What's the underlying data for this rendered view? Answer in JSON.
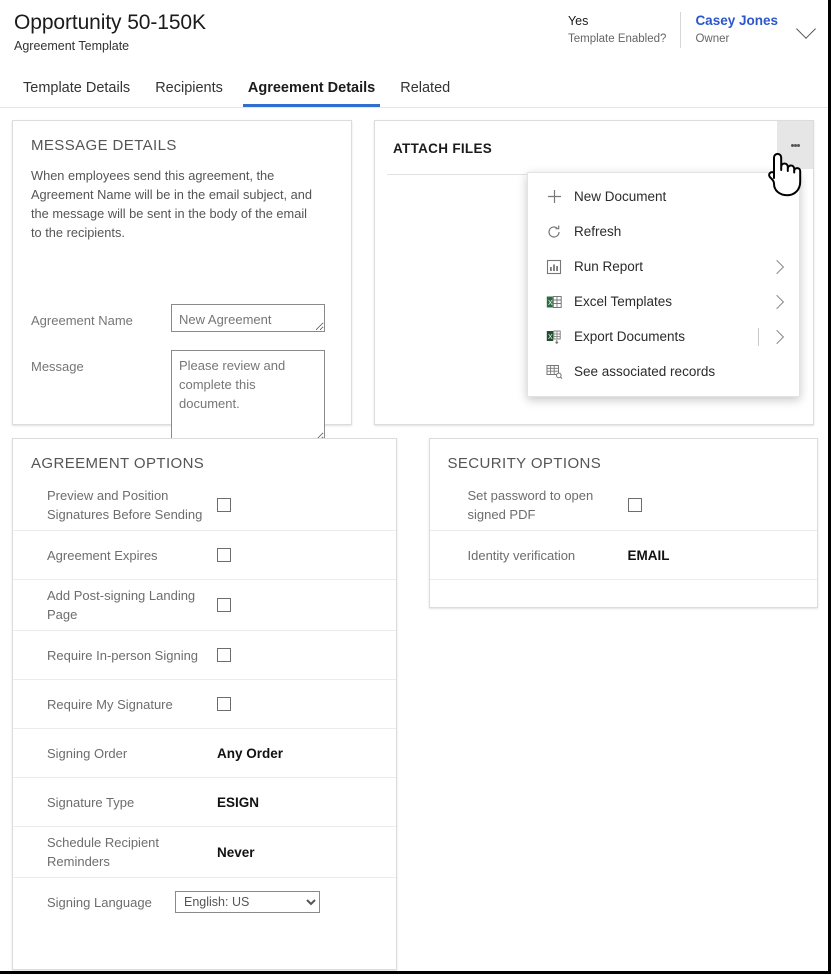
{
  "header": {
    "title": "Opportunity 50-150K",
    "subtitle": "Agreement Template",
    "template_enabled_value": "Yes",
    "template_enabled_label": "Template Enabled?",
    "owner_name": "Casey Jones",
    "owner_label": "Owner",
    "expand_icon": "chevron-down-icon"
  },
  "tabs": [
    {
      "label": "Template Details",
      "active": false
    },
    {
      "label": "Recipients",
      "active": false
    },
    {
      "label": "Agreement Details",
      "active": true
    },
    {
      "label": "Related",
      "active": false
    }
  ],
  "message_details": {
    "title": "MESSAGE DETAILS",
    "description": "When employees send this agreement, the Agreement Name will be in the email subject, and the message will be sent in the body of the email to the recipients.",
    "agreement_name_label": "Agreement Name",
    "agreement_name_value": "New Agreement",
    "message_label": "Message",
    "message_value": "Please review and complete this document."
  },
  "attach_files": {
    "title": "ATTACH FILES",
    "kebab_icon": "more-vertical-icon",
    "menu": [
      {
        "label": "New Document",
        "icon": "plus-icon",
        "submenu": false,
        "divider": false
      },
      {
        "label": "Refresh",
        "icon": "refresh-icon",
        "submenu": false,
        "divider": false
      },
      {
        "label": "Run Report",
        "icon": "report-icon",
        "submenu": true,
        "divider": false
      },
      {
        "label": "Excel Templates",
        "icon": "excel-template-icon",
        "submenu": true,
        "divider": false
      },
      {
        "label": "Export Documents",
        "icon": "excel-export-icon",
        "submenu": true,
        "divider": true
      },
      {
        "label": "See associated records",
        "icon": "associated-records-icon",
        "submenu": false,
        "divider": false
      }
    ]
  },
  "agreement_options": {
    "title": "AGREEMENT OPTIONS",
    "rows": [
      {
        "label": "Preview and Position Signatures Before Sending",
        "type": "checkbox",
        "checked": false
      },
      {
        "label": "Agreement Expires",
        "type": "checkbox",
        "checked": false
      },
      {
        "label": "Add Post-signing Landing Page",
        "type": "checkbox",
        "checked": false
      },
      {
        "label": "Require In-person Signing",
        "type": "checkbox",
        "checked": false
      },
      {
        "label": "Require My Signature",
        "type": "checkbox",
        "checked": false
      },
      {
        "label": "Signing Order",
        "type": "text",
        "value": "Any Order"
      },
      {
        "label": "Signature Type",
        "type": "text",
        "value": "ESIGN"
      },
      {
        "label": "Schedule Recipient Reminders",
        "type": "text",
        "value": "Never"
      },
      {
        "label": "Signing Language",
        "type": "select",
        "value": "English: US",
        "options": [
          "English: US"
        ]
      }
    ]
  },
  "security_options": {
    "title": "SECURITY OPTIONS",
    "rows": [
      {
        "label": "Set password to open signed PDF",
        "type": "checkbox",
        "checked": false
      },
      {
        "label": "Identity verification",
        "type": "text",
        "value": "EMAIL"
      }
    ]
  },
  "colors": {
    "accent": "#2f6fd0",
    "link": "#2b57c9",
    "card_border": "#dcdcdc",
    "kebab_bg": "#e6e6e6"
  }
}
